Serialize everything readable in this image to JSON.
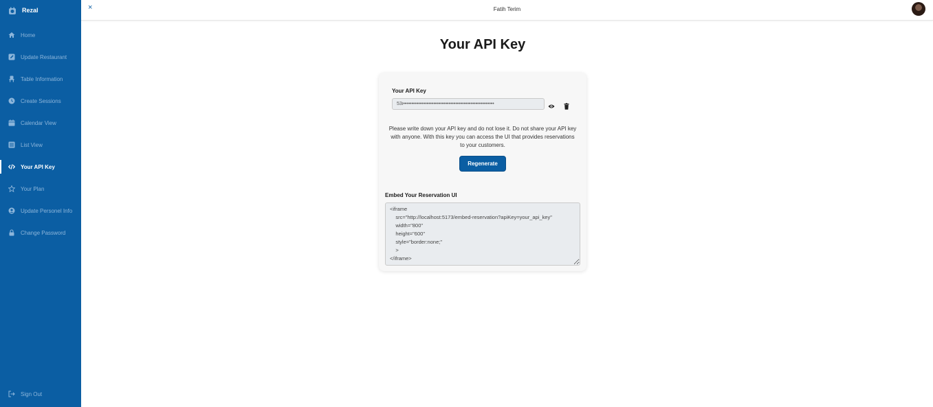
{
  "brand": {
    "name": "Rezal"
  },
  "sidebar": {
    "items": [
      {
        "label": "Home",
        "icon": "home-icon"
      },
      {
        "label": "Update Restaurant",
        "icon": "edit-icon"
      },
      {
        "label": "Table Information",
        "icon": "chair-icon"
      },
      {
        "label": "Create Sessions",
        "icon": "clock-icon"
      },
      {
        "label": "Calendar View",
        "icon": "calendar-icon"
      },
      {
        "label": "List View",
        "icon": "list-icon"
      },
      {
        "label": "Your API Key",
        "icon": "code-icon",
        "active": true
      },
      {
        "label": "Your Plan",
        "icon": "star-icon"
      },
      {
        "label": "Update Personel Info",
        "icon": "user-circle-icon"
      },
      {
        "label": "Change Password",
        "icon": "lock-icon"
      }
    ],
    "signout_label": "Sign Out"
  },
  "header": {
    "close_label": "×",
    "user_name": "Fatih Terim"
  },
  "main": {
    "title": "Your API Key",
    "api_key_label": "Your API Key",
    "api_key_value": "53i••••••••••••••••••••••••••••••••••••••••••••••••••••••",
    "warning": "Please write down your API key and do not lose it. Do not share your API key with anyone. With this key you can access the UI that provides reservations to your customers.",
    "regenerate_label": "Regenerate",
    "embed_label": "Embed Your Reservation UI",
    "embed_code": "<iframe\n    src=\"http://localhost:5173/embed-reservation?apiKey=your_api_key\"\n    width=\"800\"\n    height=\"600\"\n    style=\"border:none;\"\n    >\n</iframe>"
  },
  "colors": {
    "sidebar_bg": "#0b5ea3",
    "accent": "#0b5ea3"
  }
}
